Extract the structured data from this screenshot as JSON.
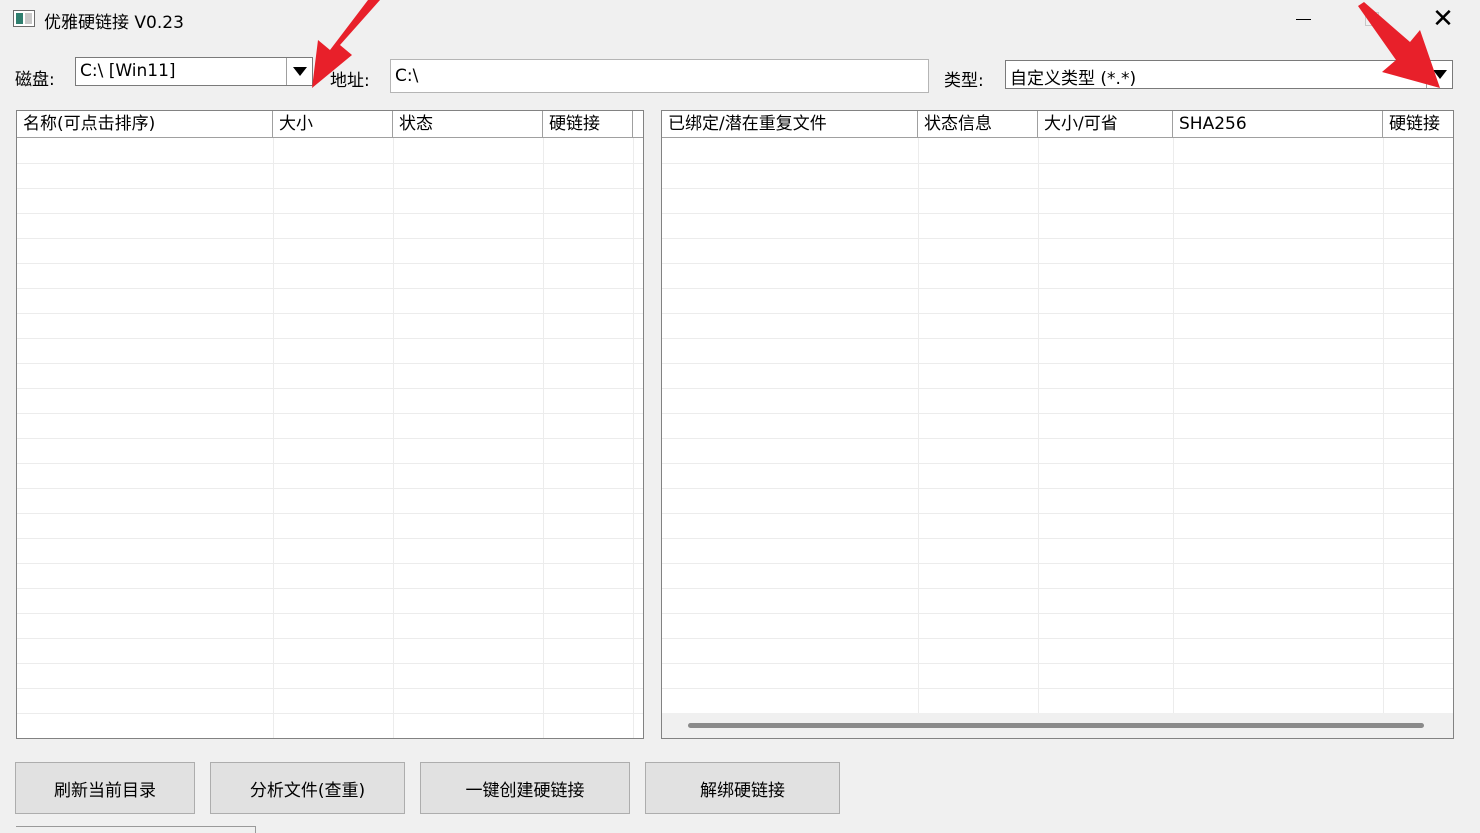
{
  "window": {
    "title": "优雅硬链接 V0.23",
    "controls": {
      "minimize": "minimize-icon",
      "maximize": "maximize-icon",
      "close": "close-icon"
    }
  },
  "toolbar": {
    "disk_label": "磁盘:",
    "disk_value": "C:\\ [Win11]",
    "address_label": "地址:",
    "address_value": "C:\\",
    "type_label": "类型:",
    "type_value": "自定义类型 (*.*)"
  },
  "left_list": {
    "columns": [
      "名称(可点击排序)",
      "大小",
      "状态",
      "硬链接"
    ],
    "rows": []
  },
  "right_list": {
    "columns": [
      "已绑定/潜在重复文件",
      "状态信息",
      "大小/可省",
      "SHA256",
      "硬链接"
    ],
    "rows": []
  },
  "buttons": {
    "refresh": "刷新当前目录",
    "analyze": "分析文件(查重)",
    "create_links": "一键创建硬链接",
    "unbind": "解绑硬链接"
  },
  "colors": {
    "annotation_arrow": "#e8202a",
    "window_bg": "#f0f0f0",
    "button_bg": "#e1e1e1"
  }
}
